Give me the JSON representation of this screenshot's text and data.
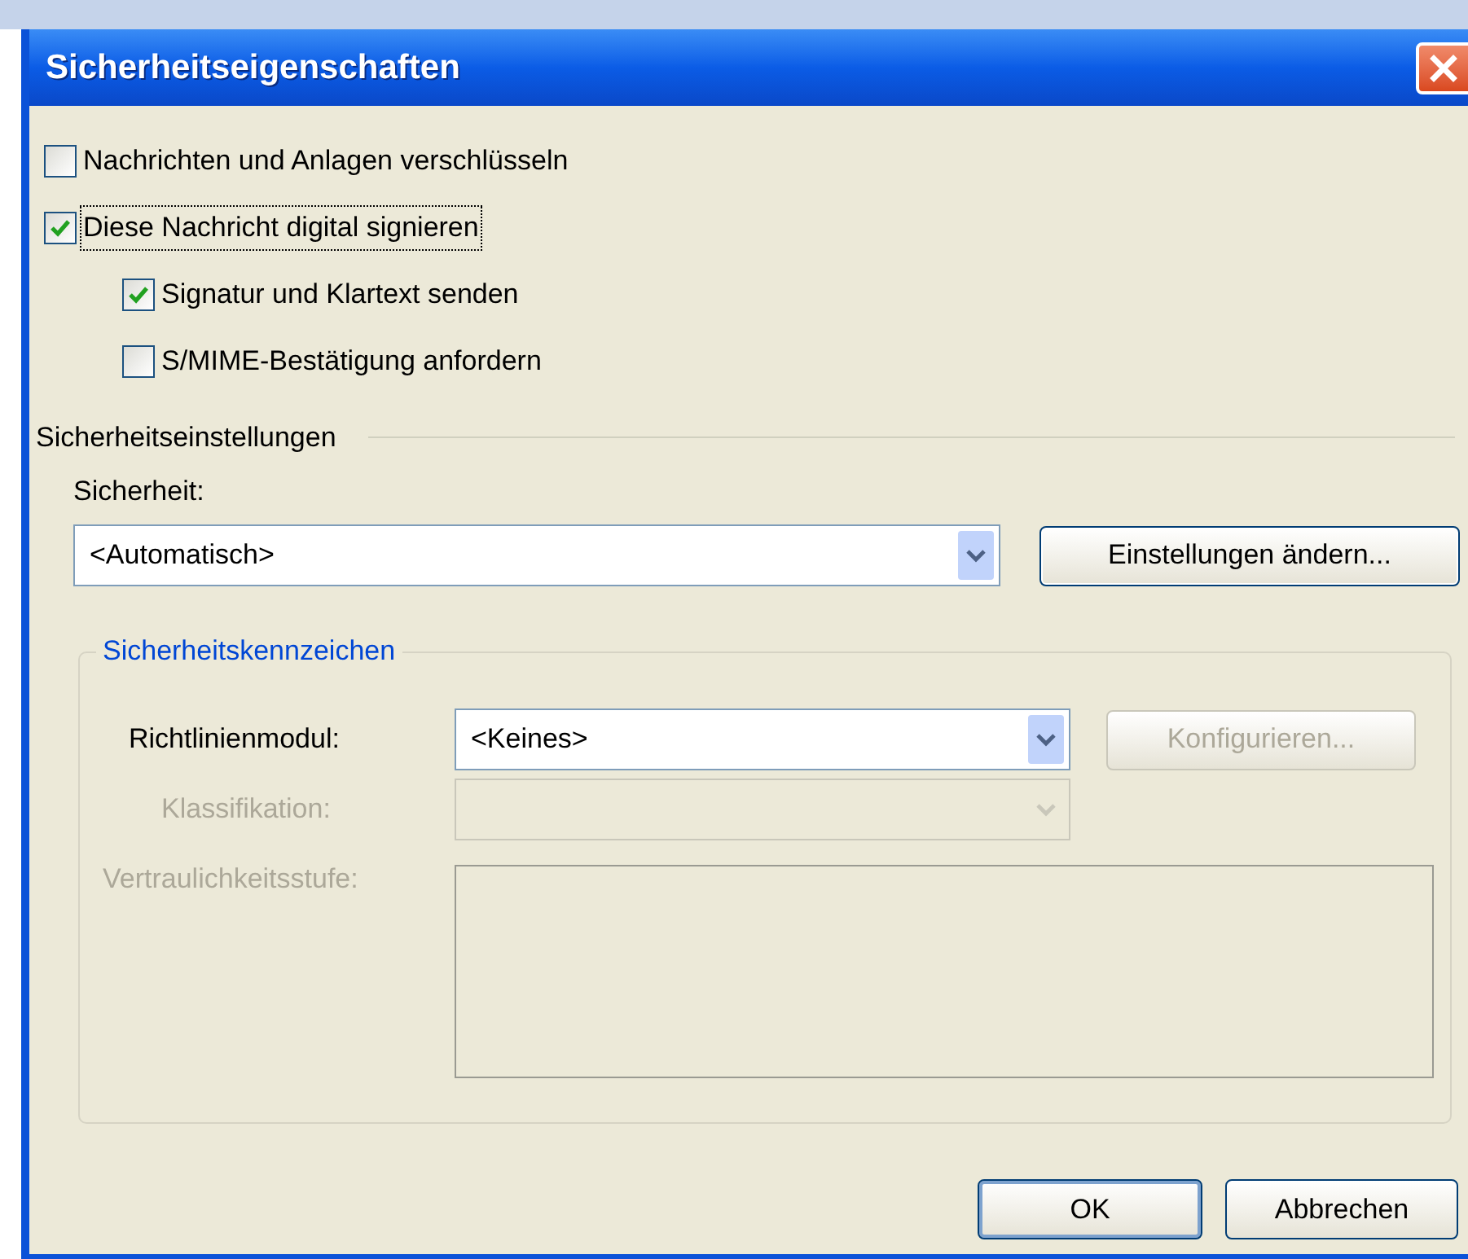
{
  "window": {
    "title": "Sicherheitseigenschaften"
  },
  "options": [
    {
      "label": "Nachrichten und Anlagen verschlüsseln",
      "checked": false,
      "focused": false
    },
    {
      "label": "Diese Nachricht digital signieren",
      "checked": true,
      "focused": true,
      "children": [
        {
          "label": "Signatur und Klartext senden",
          "checked": true,
          "focused": false
        },
        {
          "label": "S/MIME-Bestätigung anfordern",
          "checked": false,
          "focused": false
        }
      ]
    }
  ],
  "settings": {
    "heading": "Sicherheitseinstellungen",
    "security_label": "Sicherheit:",
    "security_value": "<Automatisch>",
    "change_button": "Einstellungen ändern..."
  },
  "labels_group": {
    "title": "Sicherheitskennzeichen",
    "fields": [
      {
        "kind": "combo",
        "label": "Richtlinienmodul:",
        "value": "<Keines>",
        "disabled": false
      },
      {
        "kind": "combo",
        "label": "Klassifikation:",
        "disabled": true
      },
      {
        "kind": "textarea",
        "label": "Vertraulichkeitsstufe:",
        "disabled": true
      }
    ],
    "configure_button": {
      "label": "Konfigurieren...",
      "disabled": true
    }
  },
  "buttons": [
    {
      "label": "OK",
      "default": true
    },
    {
      "label": "Abbrechen",
      "default": false
    }
  ]
}
